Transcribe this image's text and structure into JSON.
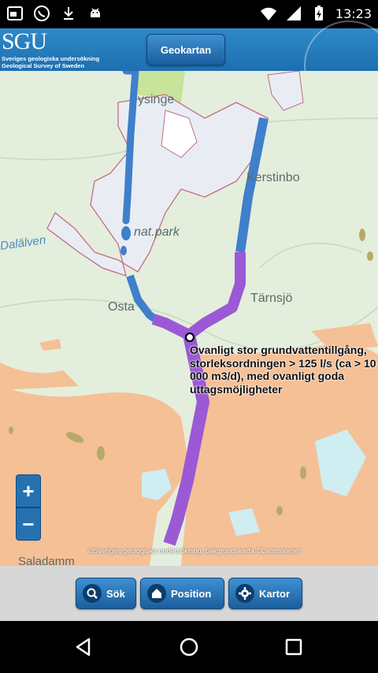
{
  "status_bar": {
    "time": "13:23",
    "icons": [
      "window-icon",
      "whatsapp-icon",
      "download-icon",
      "android-icon",
      "wifi-icon",
      "signal-icon",
      "battery-charging-icon"
    ]
  },
  "header": {
    "logo": "SGU",
    "logo_line1": "Sveriges geologiska undersökning",
    "logo_line2": "Geological Survey of Sweden",
    "geo_button": "Geokartan"
  },
  "map": {
    "places": [
      "ysinge",
      "Kerstinbo",
      "nat.park",
      "Osta",
      "Tärnsjö"
    ],
    "river_label": "Dalälven",
    "popup_text": "Ovanligt stor grundvattentillgång, storleksordningen > 125 l/s (ca > 10 000 m3/d), med ovanligt goda uttagsmöjligheter",
    "attribution": "©Sveriges geologiska undersökning, bakgrundskarta ©Lantmäteriet",
    "bottom_place": "Saladamm",
    "zoom_in": "+",
    "zoom_out": "−"
  },
  "toolbar": {
    "search": "Sök",
    "position": "Position",
    "maps": "Kartor"
  },
  "colors": {
    "accent": "#1d6fb0",
    "sand": "#f5c096",
    "groundwater_high": "#9b59d6",
    "groundwater_med": "#3f7fcc"
  }
}
